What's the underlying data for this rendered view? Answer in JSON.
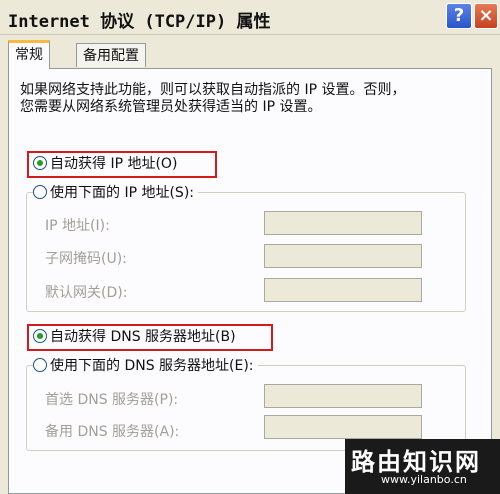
{
  "window": {
    "title": "Internet 协议 (TCP/IP) 属性",
    "help_glyph": "?",
    "close_glyph": "×"
  },
  "tabs": [
    {
      "label": "常规",
      "active": true
    },
    {
      "label": "备用配置",
      "active": false
    }
  ],
  "description": {
    "line1": "如果网络支持此功能，则可以获取自动指派的 IP 设置。否则，",
    "line2": "您需要从网络系统管理员处获得适当的 IP 设置。"
  },
  "ip": {
    "auto_label": "自动获得 IP 地址(O)",
    "auto_selected": true,
    "manual_label": "使用下面的 IP 地址(S):",
    "manual_selected": false,
    "fields": [
      {
        "label": "IP 地址(I):",
        "value": ""
      },
      {
        "label": "子网掩码(U):",
        "value": ""
      },
      {
        "label": "默认网关(D):",
        "value": ""
      }
    ]
  },
  "dns": {
    "auto_label": "自动获得 DNS 服务器地址(B)",
    "auto_selected": true,
    "manual_label": "使用下面的 DNS 服务器地址(E):",
    "manual_selected": false,
    "fields": [
      {
        "label": "首选 DNS 服务器(P):",
        "value": ""
      },
      {
        "label": "备用 DNS 服务器(A):",
        "value": ""
      }
    ]
  },
  "watermark": {
    "title": "路由知识网",
    "url": "www.yilanbo.cn"
  },
  "colors": {
    "highlight_box": "#d21c1c",
    "selected_radio": "#21a121",
    "tab_accent": "#f7b944"
  }
}
